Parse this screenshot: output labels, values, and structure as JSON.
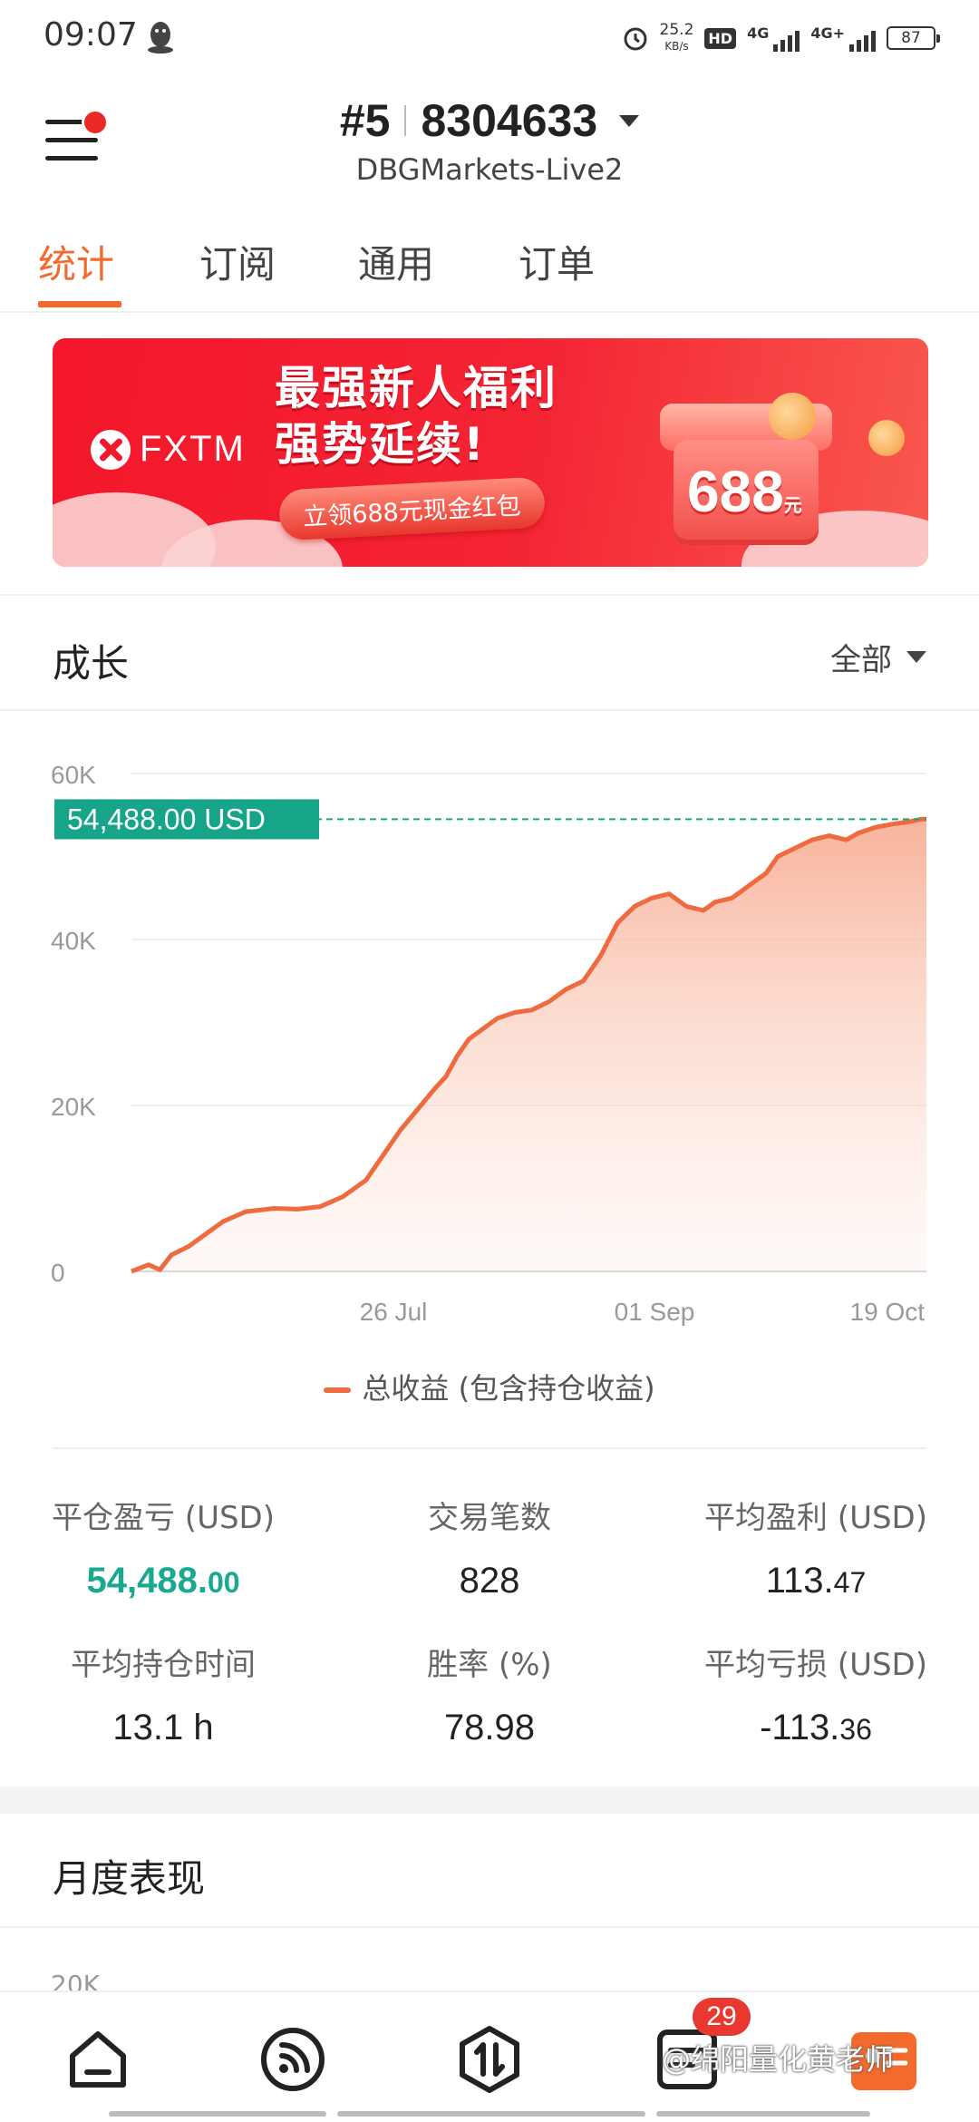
{
  "status_bar": {
    "time": "09:07",
    "net_speed_value": "25.2",
    "net_speed_unit": "KB/s",
    "hd_badge": "HD",
    "sim1_label": "4G",
    "sim2_label": "4G+",
    "battery": "87"
  },
  "header": {
    "account_index": "#5",
    "account_number": "8304633",
    "server": "DBGMarkets-Live2"
  },
  "tabs": [
    {
      "label": "统计",
      "active": true
    },
    {
      "label": "订阅",
      "active": false
    },
    {
      "label": "通用",
      "active": false
    },
    {
      "label": "订单",
      "active": false
    }
  ],
  "banner": {
    "brand": "FXTM",
    "title_line1": "最强新人福利",
    "title_line2": "强势延续!",
    "pill_text": "立领688元现金红包",
    "amount": "688",
    "amount_unit": "元"
  },
  "growth_section": {
    "title": "成长",
    "range_label": "全部"
  },
  "chart_data": {
    "type": "area",
    "series": [
      {
        "name": "总收益 (包含持仓收益)",
        "color": "#ee6a3f",
        "x_days": [
          0,
          3,
          5,
          7,
          10,
          13,
          16,
          20,
          25,
          29,
          33,
          37,
          41,
          44,
          47,
          50,
          53,
          55,
          57,
          59,
          61,
          64,
          67,
          70,
          73,
          76,
          79,
          82,
          85,
          88,
          91,
          94,
          97,
          100,
          102,
          105,
          108,
          111,
          113,
          116,
          119,
          122,
          125,
          127,
          130,
          133,
          136,
          138,
          139
        ],
        "values": [
          0,
          800,
          200,
          2000,
          3000,
          4500,
          6000,
          7200,
          7600,
          7500,
          7800,
          9000,
          11000,
          14000,
          17000,
          19500,
          22000,
          23500,
          26000,
          28000,
          29000,
          30500,
          31200,
          31500,
          32500,
          34000,
          35000,
          38000,
          42000,
          44000,
          45000,
          45500,
          44000,
          43500,
          44500,
          45000,
          46500,
          48000,
          50000,
          51000,
          52000,
          52500,
          52000,
          52800,
          53500,
          53900,
          54200,
          54488,
          54488
        ]
      }
    ],
    "x_tick_labels": [
      "26 Jul",
      "01 Sep",
      "19 Oct"
    ],
    "y_tick_labels": [
      "60K",
      "40K",
      "20K",
      "0"
    ],
    "ylim": [
      0,
      60000
    ],
    "latest_value_label": "54,488.00 USD",
    "grid": true,
    "legend_position": "bottom"
  },
  "stats": {
    "closed_pnl_label": "平仓盈亏 (USD)",
    "closed_pnl_int": "54,488.",
    "closed_pnl_dec": "00",
    "trades_label": "交易笔数",
    "trades_value": "828",
    "avg_profit_label": "平均盈利 (USD)",
    "avg_profit_int": "113.",
    "avg_profit_dec": "47",
    "avg_hold_label": "平均持仓时间",
    "avg_hold_value": "13.1 h",
    "win_rate_label": "胜率 (%)",
    "win_rate_value": "78.98",
    "avg_loss_label": "平均亏损 (USD)",
    "avg_loss_int": "-113.",
    "avg_loss_dec": "36"
  },
  "monthly_section": {
    "title": "月度表现",
    "partial_axis_label": "20K"
  },
  "bottom_nav": {
    "items": [
      "home-icon",
      "signal-feed-icon",
      "trade-icon",
      "orders-icon",
      "profile-icon"
    ],
    "badge": "29"
  },
  "watermark": "@绵阳量化黄老师"
}
